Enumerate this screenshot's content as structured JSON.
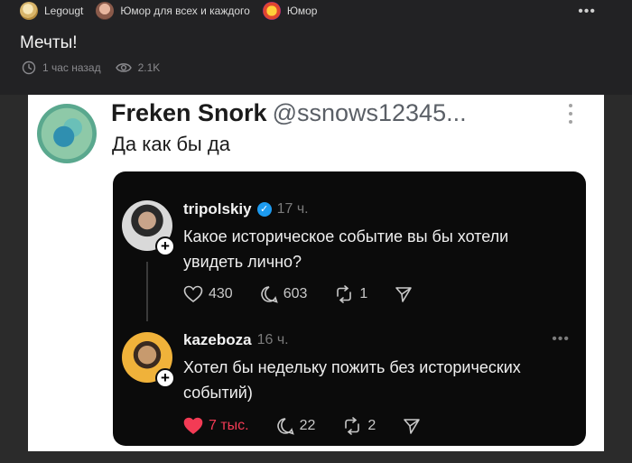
{
  "breadcrumb": {
    "author": "Legougt",
    "community": "Юмор для всех и каждого",
    "tag": "Юмор"
  },
  "post": {
    "title": "Мечты!",
    "time": "1 час назад",
    "views": "2.1K"
  },
  "tweet": {
    "name": "Freken Snork",
    "handle": "@ssnows12345...",
    "text": "Да как бы да"
  },
  "thread": {
    "first": {
      "user": "tripolskiy",
      "time": "17 ч.",
      "text": "Какое историческое событие вы бы хотели увидеть лично?",
      "likes": "430",
      "comments": "603",
      "reposts": "1"
    },
    "reply": {
      "user": "kazeboza",
      "time": "16 ч.",
      "text": "Хотел бы недельку пожить без исторических событий)",
      "likes": "7 тыс.",
      "comments": "22",
      "reposts": "2"
    }
  },
  "colors": {
    "background": "#222224",
    "like_red": "#f33b55",
    "verified_blue": "#1d9bf0"
  },
  "icons": [
    "clock-icon",
    "eye-icon",
    "more-icon",
    "heart-icon",
    "comment-icon",
    "repost-icon",
    "share-icon",
    "verified-icon",
    "plus-icon"
  ]
}
